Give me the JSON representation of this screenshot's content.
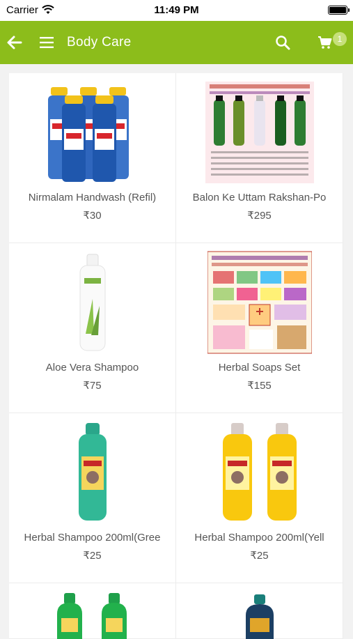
{
  "status": {
    "carrier": "Carrier",
    "time": "11:49 PM"
  },
  "appbar": {
    "title": "Body Care",
    "cart_count": "1"
  },
  "products": [
    {
      "name": "Nirmalam Handwash (Refil)",
      "price": "₹30"
    },
    {
      "name": "Balon Ke Uttam Rakshan-Po",
      "price": "₹295"
    },
    {
      "name": "Aloe Vera Shampoo",
      "price": "₹75"
    },
    {
      "name": "Herbal Soaps Set",
      "price": "₹155"
    },
    {
      "name": "Herbal Shampoo 200ml(Gree",
      "price": "₹25"
    },
    {
      "name": "Herbal Shampoo 200ml(Yell",
      "price": "₹25"
    }
  ],
  "colors": {
    "brand": "#8cbd1b",
    "badge": "#c6e07a"
  }
}
